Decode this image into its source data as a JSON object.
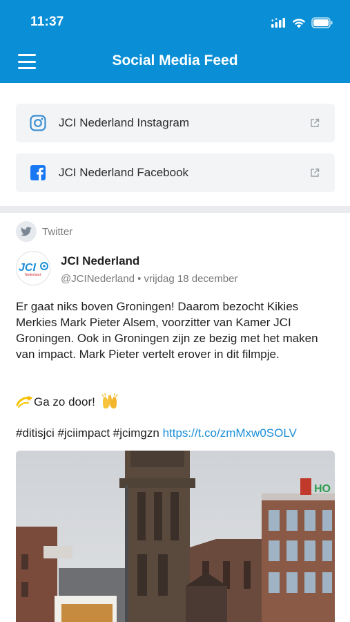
{
  "status_bar": {
    "time": "11:37"
  },
  "header": {
    "title": "Social Media Feed"
  },
  "links": [
    {
      "label": "JCI Nederland Instagram",
      "icon": "instagram-icon"
    },
    {
      "label": "JCI Nederland Facebook",
      "icon": "facebook-icon"
    }
  ],
  "post": {
    "source": "Twitter",
    "author": "JCI Nederland",
    "meta": "@JCINederland • vrijdag 18 december",
    "text": "Er gaat niks boven Groningen! Daarom bezocht Kikies Merkies Mark Pieter Alsem, voorzitter van Kamer JCI Groningen. Ook in Groningen zijn ze bezig met het maken van impact. Mark Pieter vertelt erover in dit filmpje.",
    "cheer": "Ga zo door!",
    "hashtags": "#ditisjci #jciimpact #jcimgzn",
    "link": "https://t.co/zmMxw0SOLV",
    "avatar_text": "JCI",
    "avatar_subtext": "Nederland"
  },
  "photo_sign": "HO",
  "colors": {
    "header": "#0a8fd6",
    "link": "#1b8ed8",
    "instagram": "#3b8fd3",
    "facebook": "#1877f2"
  }
}
